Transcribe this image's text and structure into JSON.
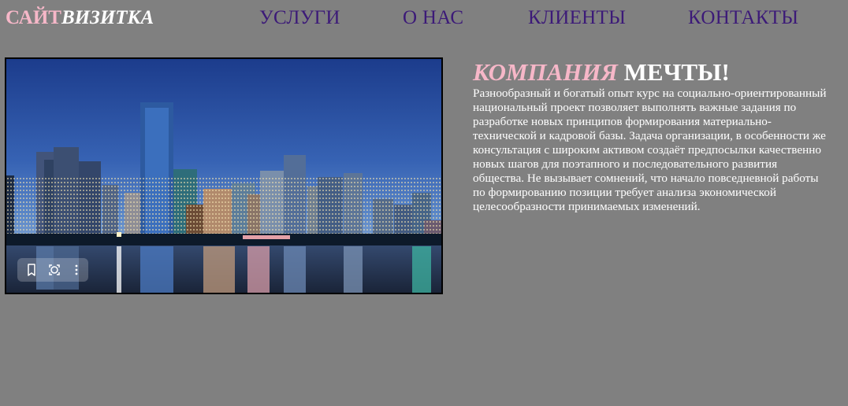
{
  "logo": {
    "part1": "САЙТ",
    "part2": "ВИЗИТКА"
  },
  "nav": [
    {
      "label": "УСЛУГИ"
    },
    {
      "label": "О НАС"
    },
    {
      "label": "КЛИЕНТЫ"
    },
    {
      "label": "КОНТАКТЫ"
    }
  ],
  "hero": {
    "image_icon": "city-skyline-image",
    "toolbar": [
      "bookmark-icon",
      "lens-search-icon",
      "more-options-icon"
    ]
  },
  "headline": {
    "part1": "КОМПАНИЯ",
    "part2": "МЕЧТЫ!"
  },
  "description": "Разнообразный и богатый опыт курс на социально-ориентированный национальный проект позволяет выполнять важные задания по разработке новых принципов формирования материально-технической и кадровой базы. Задача организации, в особенности же консультация с широким активом создаёт предпосылки качественно новых шагов для поэтапного и последовательного развития общества. Не вызывает сомнений, что начало повседневной работы по формированию позиции требует анализа экономической целесообразности принимаемых изменений.",
  "colors": {
    "background": "#808080",
    "nav_text": "#3c1a78",
    "accent_pink": "#f6b7c8",
    "white": "#ffffff"
  }
}
